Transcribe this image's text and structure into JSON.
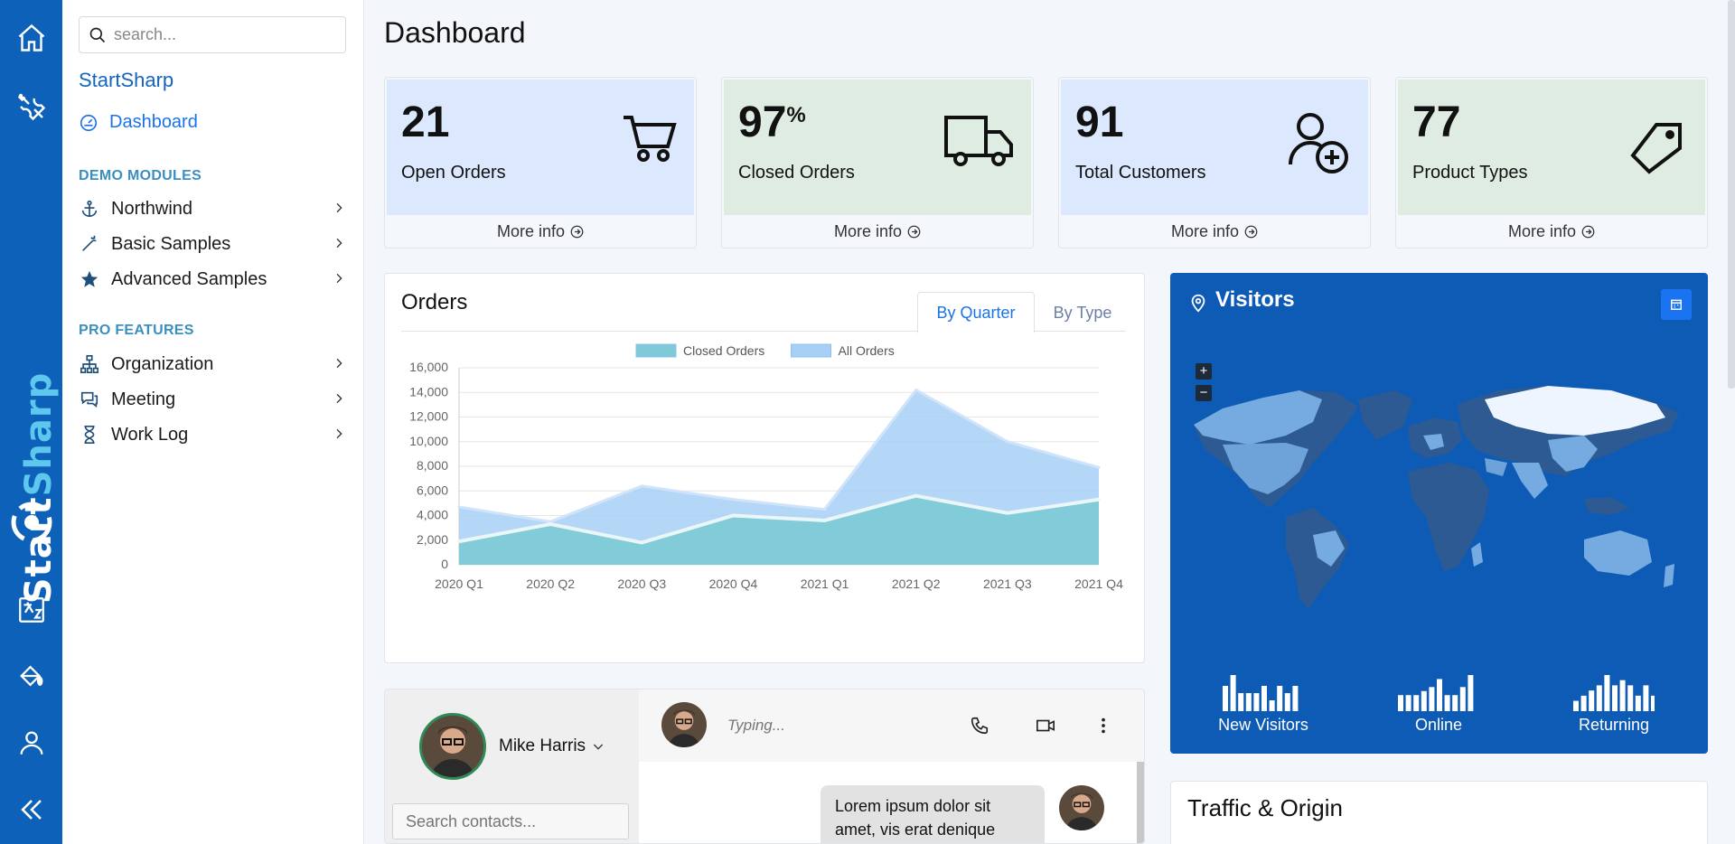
{
  "search": {
    "placeholder": "search..."
  },
  "rail": {
    "brand_part1": "Start",
    "brand_part2": "Sharp"
  },
  "sidebar": {
    "brand": "StartSharp",
    "active_item": "Dashboard",
    "sections": [
      {
        "label": "DEMO MODULES",
        "items": [
          {
            "label": "Northwind"
          },
          {
            "label": "Basic Samples"
          },
          {
            "label": "Advanced Samples"
          }
        ]
      },
      {
        "label": "PRO FEATURES",
        "items": [
          {
            "label": "Organization"
          },
          {
            "label": "Meeting"
          },
          {
            "label": "Work Log"
          }
        ]
      }
    ]
  },
  "page": {
    "title": "Dashboard"
  },
  "stats": [
    {
      "value": "21",
      "suffix": "",
      "label": "Open Orders",
      "more": "More info",
      "bg": "#dbe8fd",
      "icon": "cart-icon"
    },
    {
      "value": "97",
      "suffix": "%",
      "label": "Closed Orders",
      "more": "More info",
      "bg": "#dfece2",
      "icon": "truck-icon"
    },
    {
      "value": "91",
      "suffix": "",
      "label": "Total Customers",
      "more": "More info",
      "bg": "#dbe8fd",
      "icon": "add-user-icon"
    },
    {
      "value": "77",
      "suffix": "",
      "label": "Product Types",
      "more": "More info",
      "bg": "#dfece2",
      "icon": "tag-icon"
    }
  ],
  "orders": {
    "title": "Orders",
    "tabs": [
      {
        "label": "By Quarter",
        "active": true
      },
      {
        "label": "By Type",
        "active": false
      }
    ]
  },
  "chart_data": {
    "type": "area",
    "categories": [
      "2020 Q1",
      "2020 Q2",
      "2020 Q3",
      "2020 Q4",
      "2021 Q1",
      "2021 Q2",
      "2021 Q3",
      "2021 Q4"
    ],
    "series": [
      {
        "name": "Closed Orders",
        "values": [
          1900,
          3300,
          1800,
          4000,
          3600,
          5600,
          4200,
          5300
        ],
        "color": "#7fcad6"
      },
      {
        "name": "All Orders",
        "values": [
          4700,
          3500,
          6400,
          5300,
          4500,
          14200,
          10000,
          7900
        ],
        "color": "#a8d0f6"
      }
    ],
    "ylim": [
      0,
      16000
    ],
    "yticks": [
      "0",
      "2,000",
      "4,000",
      "6,000",
      "8,000",
      "10,000",
      "12,000",
      "14,000",
      "16,000"
    ],
    "grid": true,
    "legend_position": "top"
  },
  "visitors": {
    "title": "Visitors",
    "zoom_in": "+",
    "zoom_out": "−",
    "sparks": [
      {
        "label": "New Visitors",
        "values": [
          7,
          10,
          5,
          5,
          5,
          7,
          3,
          7,
          5,
          7
        ]
      },
      {
        "label": "Online",
        "values": [
          4,
          4,
          4,
          5,
          6,
          8,
          4,
          4,
          6,
          9
        ]
      },
      {
        "label": "Returning",
        "values": [
          2,
          3,
          4,
          5,
          7,
          5,
          6,
          5,
          3,
          5,
          3
        ]
      }
    ]
  },
  "chat": {
    "user_name": "Mike Harris",
    "contacts_placeholder": "Search contacts...",
    "typing": "Typing...",
    "message": "Lorem ipsum dolor sit amet, vis erat denique"
  },
  "traffic": {
    "title": "Traffic & Origin"
  }
}
